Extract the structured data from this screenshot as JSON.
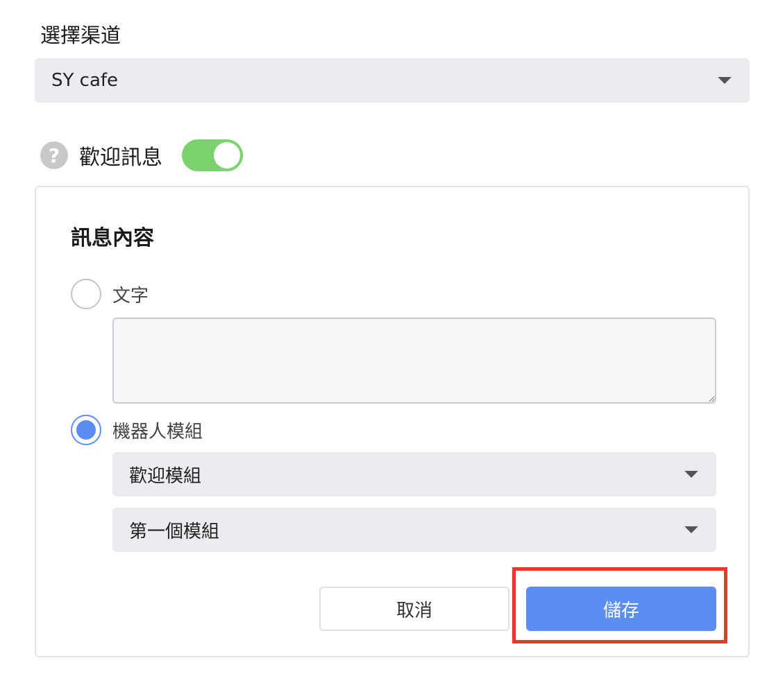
{
  "channel": {
    "label": "選擇渠道",
    "selected": "SY cafe"
  },
  "welcome": {
    "help_glyph": "?",
    "label": "歡迎訊息",
    "enabled": true,
    "toggle_color": "#7bd36f"
  },
  "message": {
    "title": "訊息內容",
    "text_option": {
      "label": "文字",
      "selected": false,
      "value": ""
    },
    "bot_option": {
      "label": "機器人模組",
      "selected": true
    },
    "module_group_select": "歡迎模組",
    "module_select": "第一個模組"
  },
  "actions": {
    "cancel_label": "取消",
    "save_label": "儲存",
    "primary_color": "#5b8ef3"
  },
  "highlight_color": "#e53a25"
}
